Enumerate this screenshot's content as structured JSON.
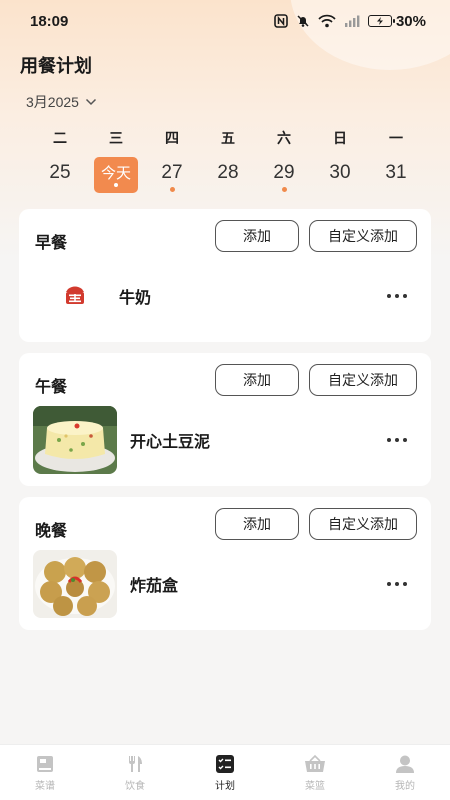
{
  "status_bar": {
    "time": "18:09",
    "battery": "30%"
  },
  "page": {
    "title": "用餐计划"
  },
  "month_selector": {
    "label": "3月2025"
  },
  "calendar": {
    "weekdays": [
      "二",
      "三",
      "四",
      "五",
      "六",
      "日",
      "一"
    ],
    "dates": [
      {
        "label": "25",
        "today": false,
        "has_dot": false
      },
      {
        "label": "今天",
        "today": true,
        "has_dot": true
      },
      {
        "label": "27",
        "today": false,
        "has_dot": true
      },
      {
        "label": "28",
        "today": false,
        "has_dot": false
      },
      {
        "label": "29",
        "today": false,
        "has_dot": true
      },
      {
        "label": "30",
        "today": false,
        "has_dot": false
      },
      {
        "label": "31",
        "today": false,
        "has_dot": false
      }
    ]
  },
  "meals": [
    {
      "title": "早餐",
      "add_label": "添加",
      "custom_label": "自定义添加",
      "items": [
        {
          "name": "牛奶",
          "thumb": "milk-icon"
        }
      ]
    },
    {
      "title": "午餐",
      "add_label": "添加",
      "custom_label": "自定义添加",
      "items": [
        {
          "name": "开心土豆泥",
          "thumb": "mashed-potato-photo"
        }
      ]
    },
    {
      "title": "晚餐",
      "add_label": "添加",
      "custom_label": "自定义添加",
      "items": [
        {
          "name": "炸茄盒",
          "thumb": "fried-eggplant-photo"
        }
      ]
    }
  ],
  "tabbar": {
    "active": "计划",
    "tabs": [
      {
        "label": "菜谱",
        "icon": "book-icon"
      },
      {
        "label": "饮食",
        "icon": "utensils-icon"
      },
      {
        "label": "计划",
        "icon": "checklist-icon"
      },
      {
        "label": "菜篮",
        "icon": "basket-icon"
      },
      {
        "label": "我的",
        "icon": "user-icon"
      }
    ]
  },
  "colors": {
    "accent": "#f28a4e",
    "dot": "#f08a4b",
    "header_bg": "#fbe3cc"
  }
}
